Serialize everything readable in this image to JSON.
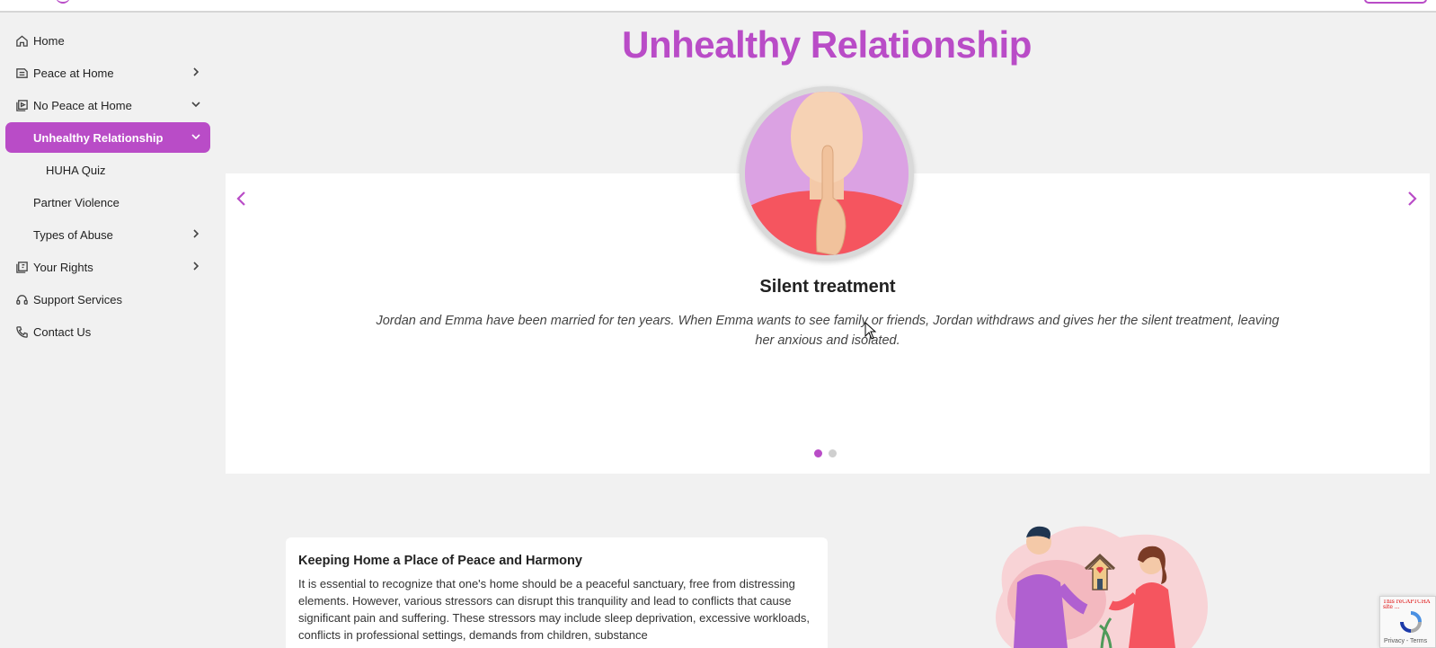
{
  "colors": {
    "brand": "#b94cc7",
    "background": "#f1f1f1",
    "panel": "#ffffff"
  },
  "sidebar": {
    "items": [
      {
        "label": "Home",
        "icon": "home-icon"
      },
      {
        "label": "Peace at Home",
        "icon": "peace-icon",
        "chevron": "chevron-right-icon"
      },
      {
        "label": "No Peace at Home",
        "icon": "stack-icon",
        "chevron": "chevron-down-icon"
      },
      {
        "label": "Unhealthy Relationship",
        "chevron": "chevron-down-icon",
        "active": true
      },
      {
        "label": "HUHA Quiz"
      },
      {
        "label": "Partner Violence"
      },
      {
        "label": "Types of Abuse",
        "chevron": "chevron-right-icon"
      },
      {
        "label": "Your Rights",
        "icon": "book-icon",
        "chevron": "chevron-right-icon"
      },
      {
        "label": "Support Services",
        "icon": "headset-icon"
      },
      {
        "label": "Contact Us",
        "icon": "phone-icon"
      }
    ]
  },
  "page": {
    "title": "Unhealthy Relationship"
  },
  "carousel": {
    "slide_title": "Silent treatment",
    "slide_text": "Jordan and Emma have been married for ten years. When Emma wants to see family or friends, Jordan withdraws and gives her the silent treatment, leaving her anxious and isolated.",
    "current_slide": 1,
    "total_slides": 2
  },
  "card": {
    "title": "Keeping Home a Place of Peace and Harmony",
    "body": "It is essential to recognize that one's home should be a peaceful sanctuary, free from distressing elements. However, various stressors can disrupt this tranquility and lead to conflicts that cause significant pain and suffering. These stressors may include sleep deprivation, excessive workloads, conflicts in professional settings, demands from children, substance"
  },
  "recaptcha": {
    "warning": "This reCAPTCHA site ...",
    "terms": "Privacy - Terms"
  }
}
